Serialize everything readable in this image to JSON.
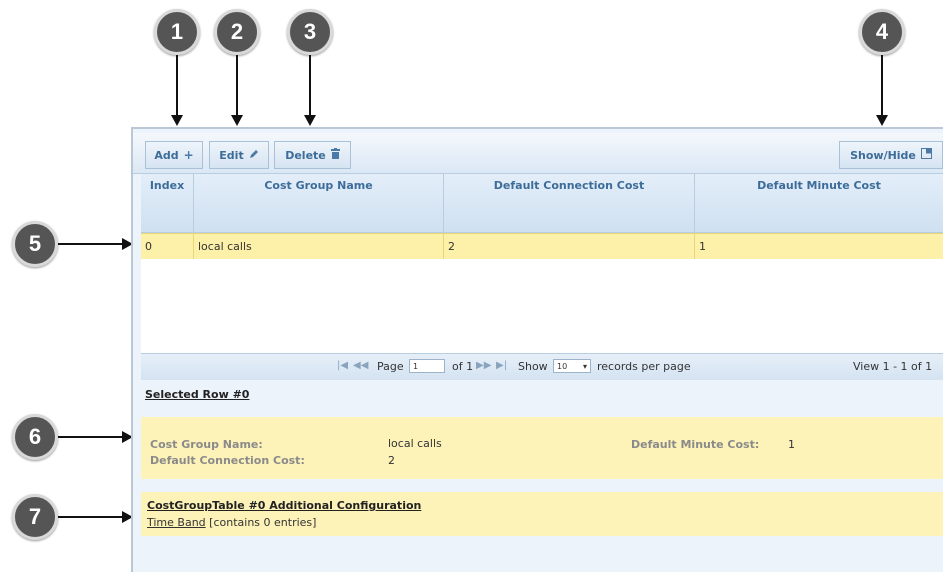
{
  "callouts": [
    "1",
    "2",
    "3",
    "4",
    "5",
    "6",
    "7"
  ],
  "toolbar": {
    "add_label": "Add",
    "edit_label": "Edit",
    "delete_label": "Delete",
    "showhide_label": "Show/Hide",
    "add_icon": "plus-icon",
    "edit_icon": "pencil-icon",
    "delete_icon": "trash-icon",
    "showhide_icon": "columns-icon"
  },
  "table": {
    "columns": [
      "Index",
      "Cost Group Name",
      "Default Connection Cost",
      "Default Minute Cost"
    ],
    "rows": [
      [
        "0",
        "local calls",
        "2",
        "1"
      ]
    ]
  },
  "pager": {
    "page_label": "Page",
    "page_value": "1",
    "of_label": "of 1",
    "show_label": "Show",
    "show_value": "10",
    "records_label": "records per page",
    "view_label": "View 1 - 1 of 1"
  },
  "selected": {
    "title": "Selected Row #0",
    "fields": {
      "cost_group_name_label": "Cost Group Name:",
      "cost_group_name_value": "local calls",
      "default_connection_cost_label": "Default Connection Cost:",
      "default_connection_cost_value": "2",
      "default_minute_cost_label": "Default Minute Cost:",
      "default_minute_cost_value": "1"
    }
  },
  "additional": {
    "title": "CostGroupTable #0 Additional Configuration",
    "link": "Time Band",
    "link_suffix": "[contains 0 entries]"
  },
  "colors": {
    "callout": "#555555",
    "highlight": "#fdf0a8",
    "header_text": "#3d6c99"
  }
}
